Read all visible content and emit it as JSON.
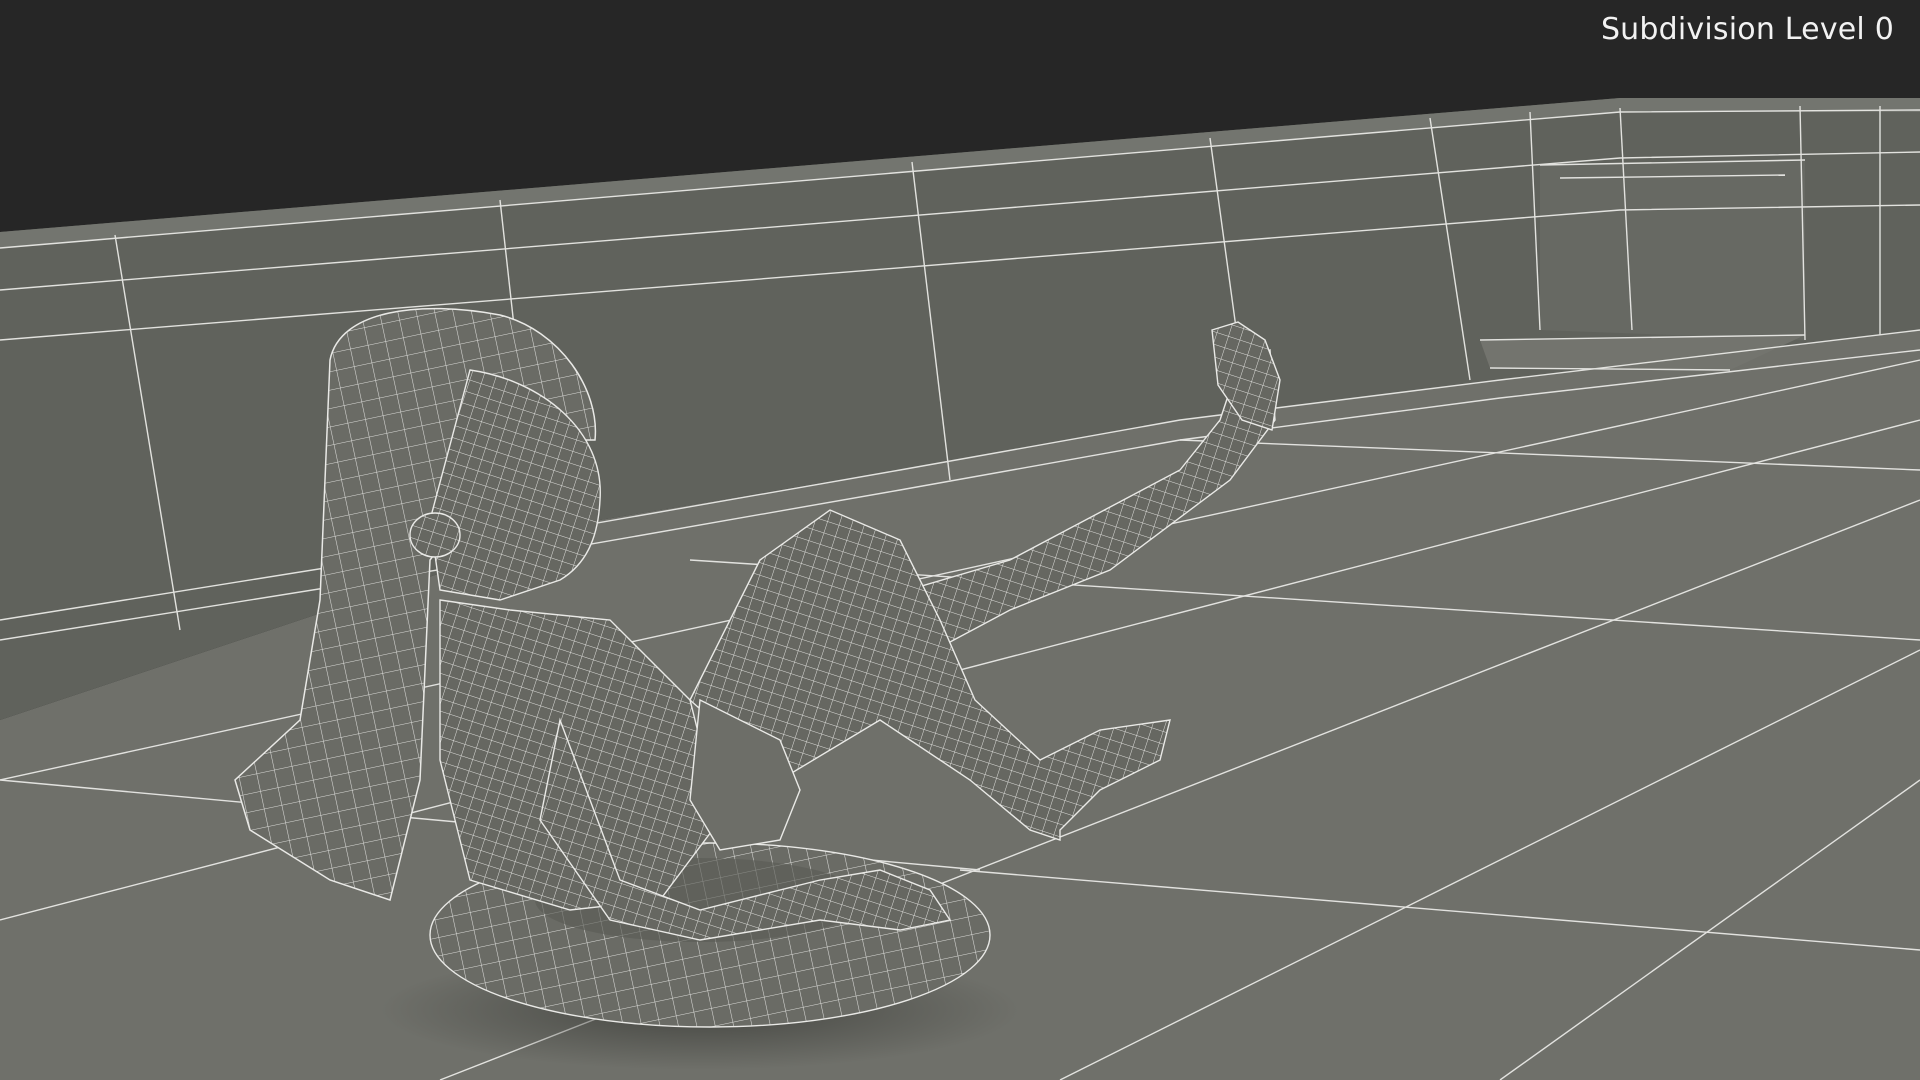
{
  "viewport": {
    "overlay_label": "Subdivision Level 0"
  },
  "scene": {
    "background_color": "#262626",
    "floor_color": "#6f706a",
    "wall_color": "#5f615b",
    "wireframe_color": "#e9e9e6",
    "mesh_color": "#6a6b65"
  }
}
